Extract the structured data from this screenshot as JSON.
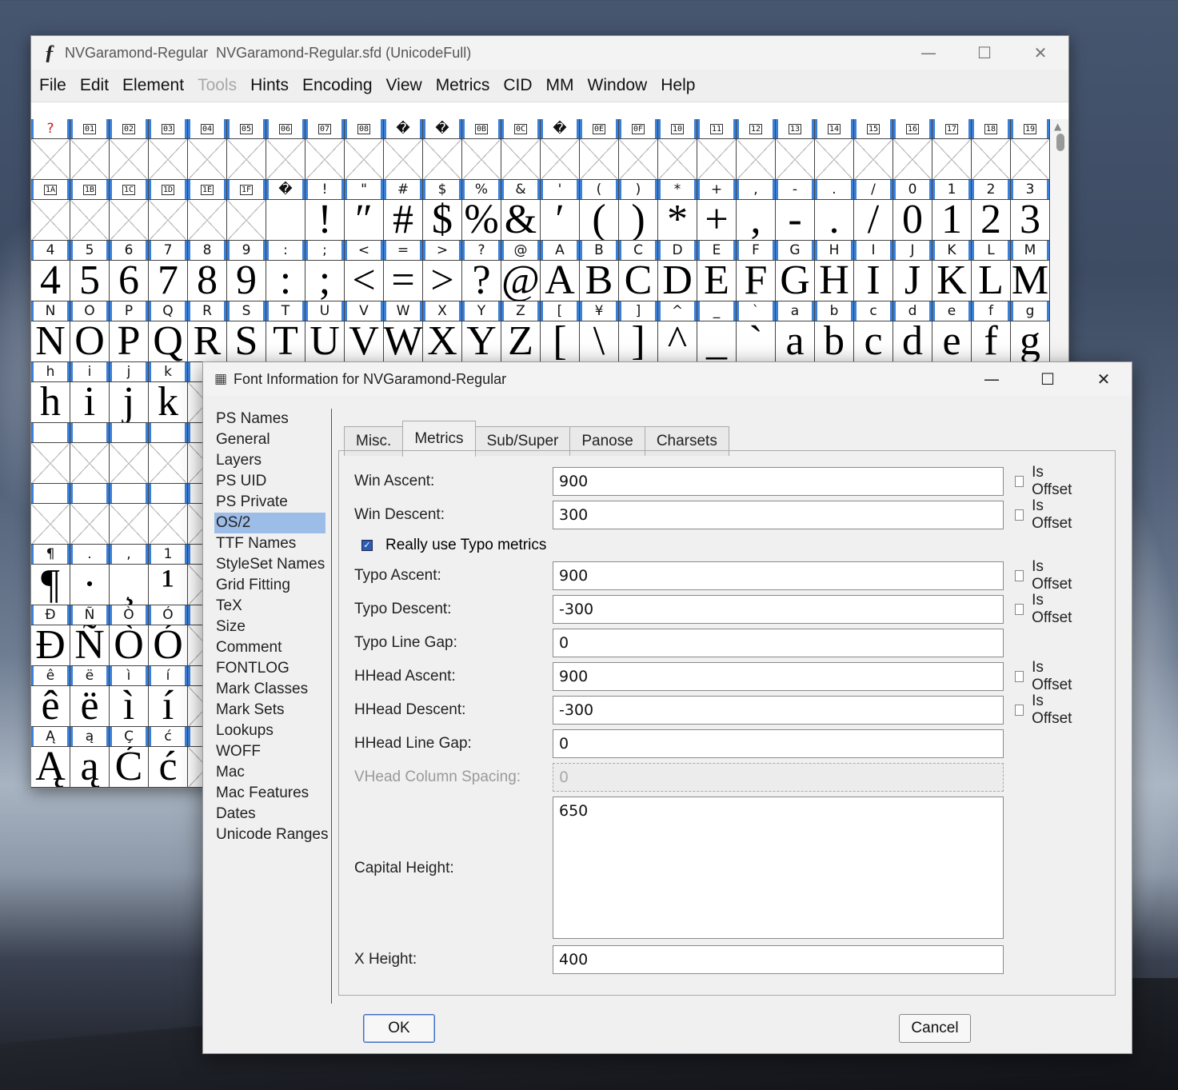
{
  "main_window": {
    "title": "NVGaramond-Regular  NVGaramond-Regular.sfd (UnicodeFull)",
    "app_icon_glyph": "ƒ",
    "menus": [
      {
        "label": "File",
        "u": "F",
        "rest": "ile",
        "enabled": true
      },
      {
        "label": "Edit",
        "u": "E",
        "rest": "dit",
        "enabled": true
      },
      {
        "label": "Element",
        "pre": "E",
        "u": "l",
        "rest": "ement",
        "enabled": true
      },
      {
        "label": "Tools",
        "u": "",
        "rest": "Tools",
        "enabled": false
      },
      {
        "label": "Hints",
        "pre": "H",
        "u": "i",
        "rest": "nts",
        "enabled": true
      },
      {
        "label": "Encoding",
        "pre": "E",
        "u": "n",
        "rest": "coding",
        "enabled": true
      },
      {
        "label": "View",
        "u": "V",
        "rest": "iew",
        "enabled": true
      },
      {
        "label": "Metrics",
        "u": "M",
        "rest": "etrics",
        "enabled": true
      },
      {
        "label": "CID",
        "u": "C",
        "rest": "ID",
        "enabled": true
      },
      {
        "label": "MM",
        "u": "",
        "rest": "MM",
        "enabled": true
      },
      {
        "label": "Window",
        "u": "W",
        "rest": "indow",
        "enabled": true
      },
      {
        "label": "Help",
        "u": "H",
        "rest": "elp",
        "enabled": true
      }
    ],
    "glyph_rows": [
      [
        [
          "?",
          ""
        ],
        [
          "01",
          ""
        ],
        [
          "02",
          ""
        ],
        [
          "03",
          ""
        ],
        [
          "04",
          ""
        ],
        [
          "05",
          ""
        ],
        [
          "06",
          ""
        ],
        [
          "07",
          ""
        ],
        [
          "08",
          ""
        ],
        [
          "�",
          ""
        ],
        [
          "�",
          ""
        ],
        [
          "0B",
          ""
        ],
        [
          "0C",
          ""
        ],
        [
          "�",
          ""
        ],
        [
          "0E",
          ""
        ],
        [
          "0F",
          ""
        ],
        [
          "10",
          ""
        ],
        [
          "11",
          ""
        ],
        [
          "12",
          ""
        ],
        [
          "13",
          ""
        ],
        [
          "14",
          ""
        ],
        [
          "15",
          ""
        ],
        [
          "16",
          ""
        ],
        [
          "17",
          ""
        ],
        [
          "18",
          ""
        ],
        [
          "19",
          ""
        ]
      ],
      [
        [
          "1A",
          ""
        ],
        [
          "1B",
          ""
        ],
        [
          "1C",
          ""
        ],
        [
          "1D",
          ""
        ],
        [
          "1E",
          ""
        ],
        [
          "1F",
          ""
        ],
        [
          "�",
          " "
        ],
        [
          "!",
          "!"
        ],
        [
          "\"",
          "″"
        ],
        [
          "#",
          "#"
        ],
        [
          "$",
          "$"
        ],
        [
          "%",
          "%"
        ],
        [
          "&",
          "&"
        ],
        [
          "'",
          "ʹ"
        ],
        [
          "(",
          "("
        ],
        [
          ")",
          ")"
        ],
        [
          "*",
          "*"
        ],
        [
          "+",
          "+"
        ],
        [
          ",",
          ","
        ],
        [
          "-",
          "-"
        ],
        [
          ".",
          "."
        ],
        [
          "/",
          "/"
        ],
        [
          "0",
          "0"
        ],
        [
          "1",
          "1"
        ],
        [
          "2",
          "2"
        ],
        [
          "3",
          "3"
        ]
      ],
      [
        [
          "4",
          "4"
        ],
        [
          "5",
          "5"
        ],
        [
          "6",
          "6"
        ],
        [
          "7",
          "7"
        ],
        [
          "8",
          "8"
        ],
        [
          "9",
          "9"
        ],
        [
          ":",
          ":"
        ],
        [
          ";",
          ";"
        ],
        [
          "<",
          "<"
        ],
        [
          "=",
          "="
        ],
        [
          ">",
          ">"
        ],
        [
          "?",
          "?"
        ],
        [
          "@",
          "@"
        ],
        [
          "A",
          "A"
        ],
        [
          "B",
          "B"
        ],
        [
          "C",
          "C"
        ],
        [
          "D",
          "D"
        ],
        [
          "E",
          "E"
        ],
        [
          "F",
          "F"
        ],
        [
          "G",
          "G"
        ],
        [
          "H",
          "H"
        ],
        [
          "I",
          "I"
        ],
        [
          "J",
          "J"
        ],
        [
          "K",
          "K"
        ],
        [
          "L",
          "L"
        ],
        [
          "M",
          "M"
        ]
      ],
      [
        [
          "N",
          "N"
        ],
        [
          "O",
          "O"
        ],
        [
          "P",
          "P"
        ],
        [
          "Q",
          "Q"
        ],
        [
          "R",
          "R"
        ],
        [
          "S",
          "S"
        ],
        [
          "T",
          "T"
        ],
        [
          "U",
          "U"
        ],
        [
          "V",
          "V"
        ],
        [
          "W",
          "W"
        ],
        [
          "X",
          "X"
        ],
        [
          "Y",
          "Y"
        ],
        [
          "Z",
          "Z"
        ],
        [
          "[",
          "["
        ],
        [
          "¥",
          "\\"
        ],
        [
          "]",
          "]"
        ],
        [
          "^",
          "^"
        ],
        [
          "_",
          "_"
        ],
        [
          "`",
          "`"
        ],
        [
          "a",
          "a"
        ],
        [
          "b",
          "b"
        ],
        [
          "c",
          "c"
        ],
        [
          "d",
          "d"
        ],
        [
          "e",
          "e"
        ],
        [
          "f",
          "f"
        ],
        [
          "g",
          "g"
        ]
      ],
      [
        [
          "h",
          "h"
        ],
        [
          "i",
          "i"
        ],
        [
          "j",
          "j"
        ],
        [
          "k",
          "k"
        ]
      ],
      [
        [
          "",
          ""
        ],
        [
          "",
          ""
        ],
        [
          "",
          ""
        ],
        [
          "",
          ""
        ]
      ],
      [
        [
          "",
          ""
        ],
        [
          "",
          ""
        ],
        [
          "",
          ""
        ],
        [
          "",
          ""
        ]
      ],
      [
        [
          "¶",
          "¶"
        ],
        [
          ".",
          "·"
        ],
        [
          ",",
          "¸"
        ],
        [
          "1",
          "¹"
        ]
      ],
      [
        [
          "Ð",
          "Ð"
        ],
        [
          "Ñ",
          "Ñ"
        ],
        [
          "Ò",
          "Ò"
        ],
        [
          "Ó",
          "Ó"
        ]
      ],
      [
        [
          "ê",
          "ê"
        ],
        [
          "ë",
          "ë"
        ],
        [
          "ì",
          "ì"
        ],
        [
          "í",
          "í"
        ]
      ],
      [
        [
          "Ą",
          "Ą"
        ],
        [
          "ą",
          "ą"
        ],
        [
          "Ç",
          "Ć"
        ],
        [
          "ć",
          "ć"
        ]
      ]
    ]
  },
  "dialog": {
    "title": "Font Information for NVGaramond-Regular",
    "sidebar": [
      "PS Names",
      "General",
      "Layers",
      "PS UID",
      "PS Private",
      "OS/2",
      "TTF Names",
      "StyleSet Names",
      "Grid Fitting",
      "TeX",
      "Size",
      "Comment",
      "FONTLOG",
      "Mark Classes",
      "Mark Sets",
      "Lookups",
      "WOFF",
      "Mac",
      "Mac Features",
      "Dates",
      "Unicode Ranges"
    ],
    "sidebar_selected": "OS/2",
    "tabs": [
      "Misc.",
      "Metrics",
      "Sub/Super",
      "Panose",
      "Charsets"
    ],
    "active_tab": "Metrics",
    "fields": {
      "win_ascent": {
        "label": "Win Ascent:",
        "value": "900",
        "is_offset": false
      },
      "win_descent": {
        "label": "Win Descent:",
        "value": "300",
        "is_offset": false
      },
      "really_use_typo": {
        "label": "Really use Typo metrics",
        "checked": true
      },
      "typo_ascent": {
        "label": "Typo Ascent:",
        "value": "900",
        "is_offset": false
      },
      "typo_descent": {
        "label": "Typo Descent:",
        "value": "-300",
        "is_offset": false
      },
      "typo_line_gap": {
        "label": "Typo Line Gap:",
        "value": "0"
      },
      "hhead_ascent": {
        "label": "HHead Ascent:",
        "value": "900",
        "is_offset": false
      },
      "hhead_descent": {
        "label": "HHead Descent:",
        "value": "-300",
        "is_offset": false
      },
      "hhead_line_gap": {
        "label": "HHead Line Gap:",
        "value": "0"
      },
      "vhead_column_spacing": {
        "label": "VHead Column Spacing:",
        "value": "0",
        "enabled": false
      },
      "capital_height": {
        "label": "Capital Height:",
        "value": "650"
      },
      "x_height": {
        "label": "X Height:",
        "value": "400"
      }
    },
    "is_offset_label": "Is Offset",
    "ok_label": "OK",
    "cancel_label": "Cancel",
    "selection_color": "#9cbde8",
    "accent_color": "#2b5db1"
  }
}
